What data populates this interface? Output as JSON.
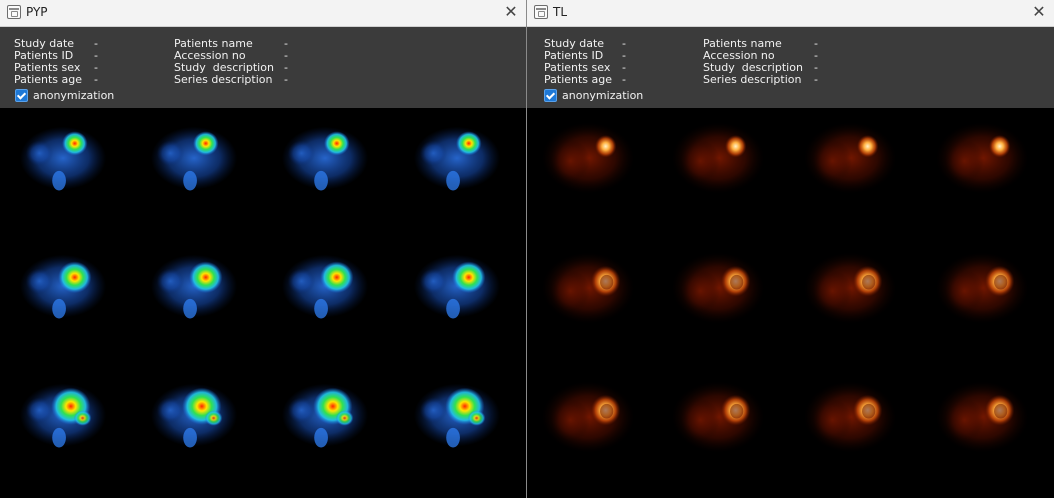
{
  "windows": [
    {
      "title": "PYP",
      "close_icon": "close-icon",
      "info": {
        "left": [
          {
            "label": "Study date",
            "value": "-"
          },
          {
            "label": "Patients ID",
            "value": "-"
          },
          {
            "label": "Patients sex",
            "value": "-"
          },
          {
            "label": "Patients age",
            "value": "-"
          }
        ],
        "right": [
          {
            "label": "Patients name",
            "value": "-"
          },
          {
            "label": "Accession no",
            "value": "-"
          },
          {
            "label": "Study  description",
            "value": "-"
          },
          {
            "label": "Series description",
            "value": "-"
          }
        ]
      },
      "anonymization": {
        "label": "anonymization",
        "checked": true
      },
      "colormap": "rainbow",
      "grid": {
        "rows": 3,
        "cols": 4
      }
    },
    {
      "title": "TL",
      "close_icon": "close-icon",
      "info": {
        "left": [
          {
            "label": "Study date",
            "value": "-"
          },
          {
            "label": "Patients ID",
            "value": "-"
          },
          {
            "label": "Patients sex",
            "value": "-"
          },
          {
            "label": "Patients age",
            "value": "-"
          }
        ],
        "right": [
          {
            "label": "Patients name",
            "value": "-"
          },
          {
            "label": "Accession no",
            "value": "-"
          },
          {
            "label": "Study  description",
            "value": "-"
          },
          {
            "label": "Series description",
            "value": "-"
          }
        ]
      },
      "anonymization": {
        "label": "anonymization",
        "checked": true
      },
      "colormap": "hot",
      "grid": {
        "rows": 3,
        "cols": 4
      }
    }
  ]
}
